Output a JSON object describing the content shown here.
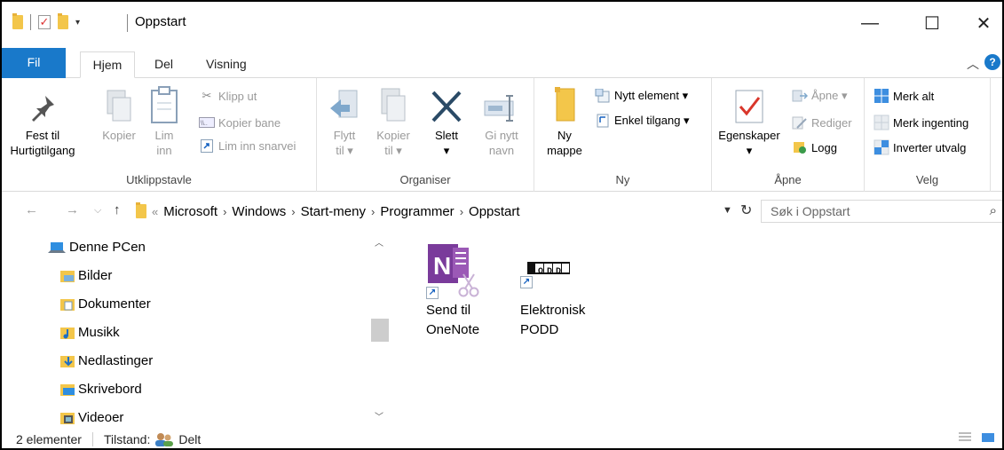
{
  "window": {
    "title": "Oppstart",
    "minimize_glyph": "—",
    "maximize_glyph": "☐",
    "close_glyph": "✕"
  },
  "tabs": {
    "fil": "Fil",
    "hjem": "Hjem",
    "del": "Del",
    "visning": "Visning"
  },
  "ribbon": {
    "utklippstavle": {
      "label": "Utklippstavle",
      "fest_til": "Fest til\nHurtigtilgang",
      "kopier": "Kopier",
      "lim_inn": "Lim\ninn",
      "klipp_ut": "Klipp ut",
      "kopier_bane": "Kopier bane",
      "lim_inn_snarvei": "Lim inn snarvei"
    },
    "organiser": {
      "label": "Organiser",
      "flytt_til": "Flytt\ntil ▾",
      "kopier_til": "Kopier\ntil ▾",
      "slett": "Slett\n▾",
      "gi_nytt_navn": "Gi nytt\nnavn"
    },
    "ny": {
      "label": "Ny",
      "ny_mappe": "Ny\nmappe",
      "nytt_element": "Nytt element ▾",
      "enkel_tilgang": "Enkel tilgang ▾"
    },
    "apne": {
      "label": "Åpne",
      "egenskaper": "Egenskaper\n▾",
      "apne": "Åpne ▾",
      "rediger": "Rediger",
      "logg": "Logg"
    },
    "velg": {
      "label": "Velg",
      "merk_alt": "Merk alt",
      "merk_ingenting": "Merk ingenting",
      "inverter_utvalg": "Inverter utvalg"
    }
  },
  "address": {
    "crumbs": [
      "Microsoft",
      "Windows",
      "Start-meny",
      "Programmer",
      "Oppstart"
    ],
    "overflow": "«",
    "search_placeholder": "Søk i Oppstart"
  },
  "navpane": {
    "items": [
      {
        "label": "Denne PCen"
      },
      {
        "label": "Bilder"
      },
      {
        "label": "Dokumenter"
      },
      {
        "label": "Musikk"
      },
      {
        "label": "Nedlastinger"
      },
      {
        "label": "Skrivebord"
      },
      {
        "label": "Videoer"
      }
    ]
  },
  "files": [
    {
      "name": "Send til\nOneNote",
      "icon": "onenote-icon"
    },
    {
      "name": "Elektronisk\nPODD",
      "icon": "podd-icon",
      "logo_text": "PODD"
    }
  ],
  "status": {
    "count": "2 elementer",
    "state_label": "Tilstand:",
    "state_value": "Delt"
  },
  "colors": {
    "accent": "#1979ca",
    "folder": "#f3c64a",
    "onenote": "#7a3b9b"
  }
}
